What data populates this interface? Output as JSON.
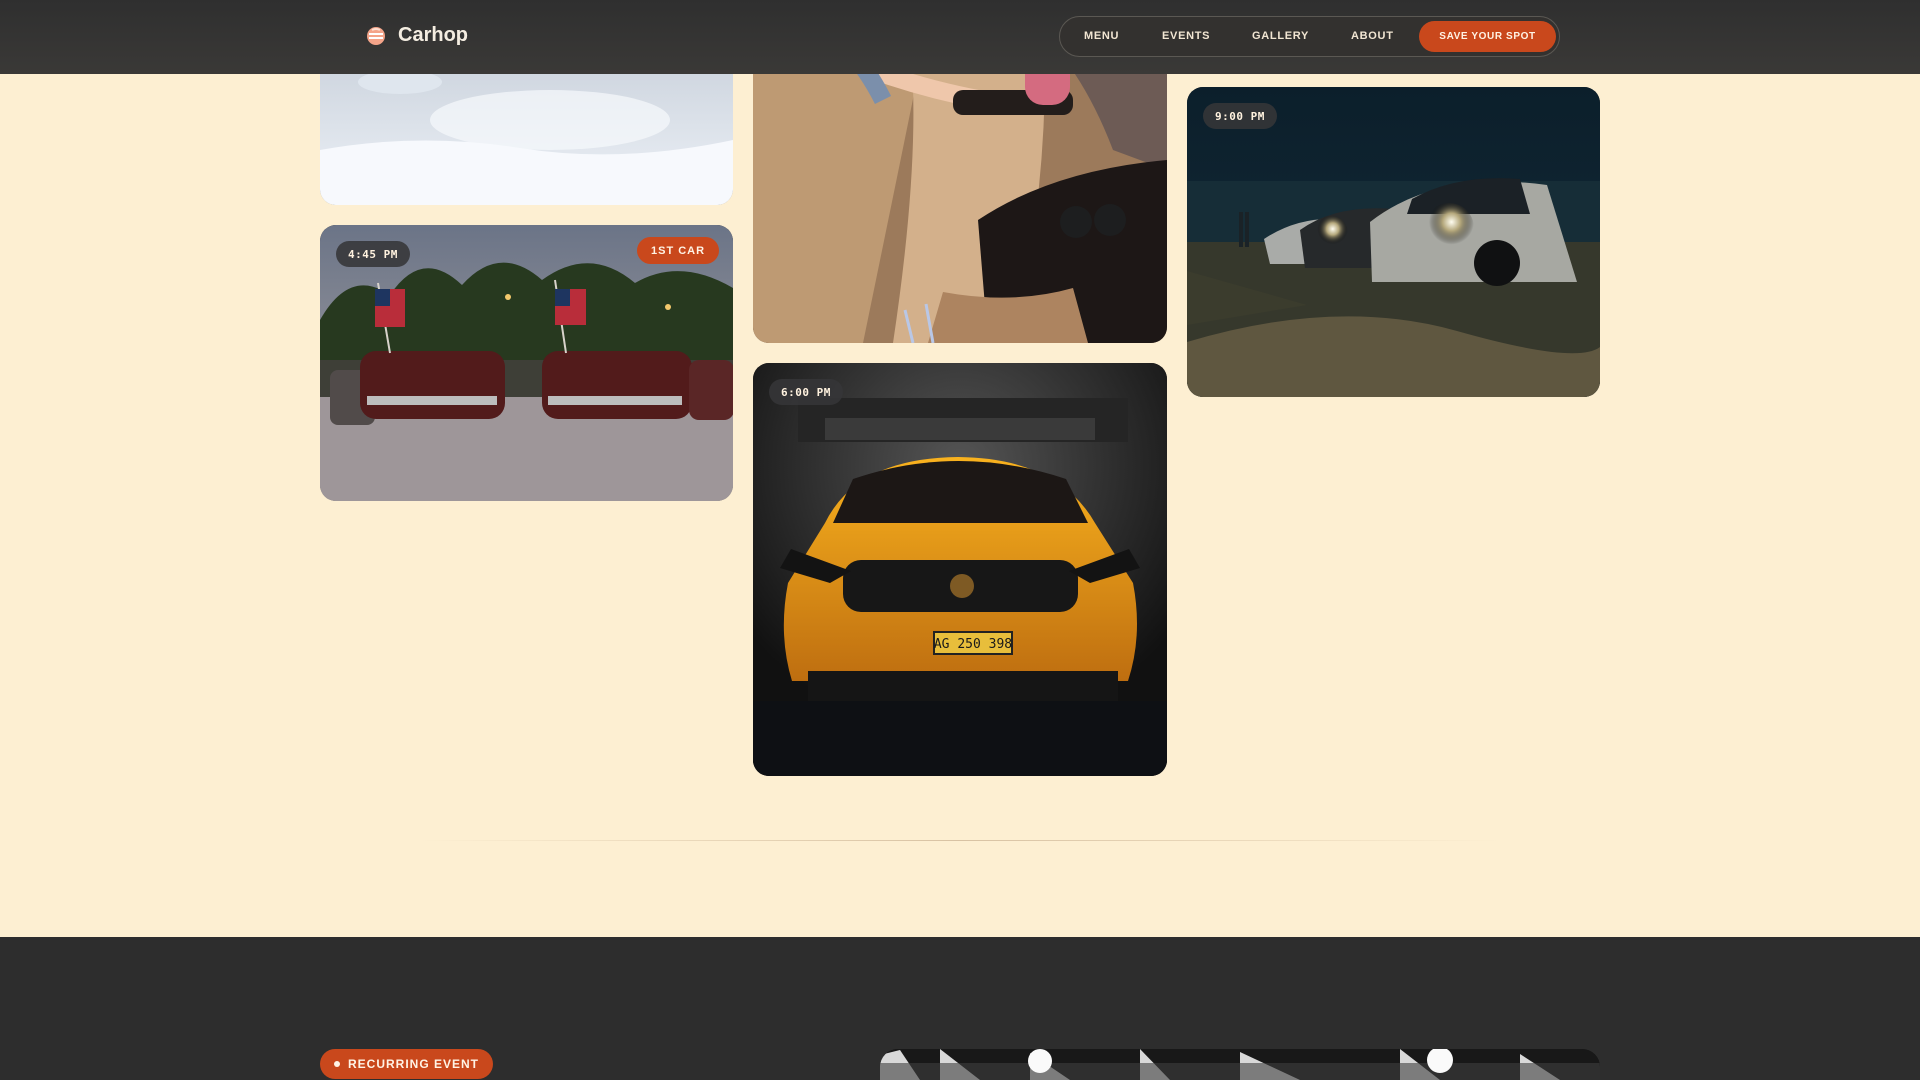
{
  "header": {
    "brand": "Carhop",
    "nav": [
      "MENU",
      "EVENTS",
      "GALLERY",
      "ABOUT"
    ],
    "cta_label": "SAVE YOUR SPOT"
  },
  "gallery": {
    "cards": [
      {
        "time": ""
      },
      {
        "time": "4:45 PM",
        "tag": "1ST CAR"
      },
      {
        "time": ""
      },
      {
        "time": "6:00 PM"
      },
      {
        "time": "9:00 PM"
      }
    ],
    "plate_text": "AG 250 398"
  },
  "event_section": {
    "badge": "RECURRING EVENT"
  },
  "colors": {
    "background": "#fdefd2",
    "header": "#343332",
    "accent": "#c9481c",
    "dark_section": "#2d2d2d"
  }
}
